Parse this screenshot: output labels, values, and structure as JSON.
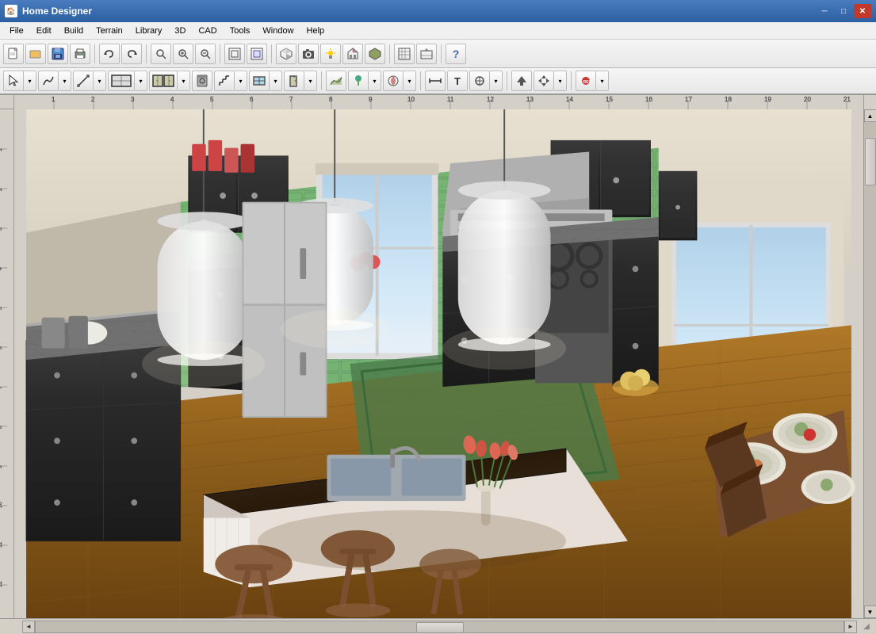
{
  "app": {
    "title": "Home Designer",
    "icon": "🏠"
  },
  "window_controls": {
    "minimize": "─",
    "maximize": "□",
    "close": "✕"
  },
  "menu": {
    "items": [
      "File",
      "Edit",
      "Build",
      "Terrain",
      "Library",
      "3D",
      "CAD",
      "Tools",
      "Window",
      "Help"
    ]
  },
  "toolbar1": {
    "buttons": [
      {
        "name": "new",
        "icon": "📄"
      },
      {
        "name": "open",
        "icon": "📂"
      },
      {
        "name": "save",
        "icon": "💾"
      },
      {
        "name": "print",
        "icon": "🖨"
      },
      {
        "name": "undo",
        "icon": "↩"
      },
      {
        "name": "redo",
        "icon": "↪"
      },
      {
        "name": "zoom-in-glass",
        "icon": "🔍"
      },
      {
        "name": "zoom-in-plus",
        "icon": "+"
      },
      {
        "name": "zoom-out",
        "icon": "-"
      },
      {
        "name": "zoom-fit",
        "icon": "⊞"
      },
      {
        "name": "zoom-window",
        "icon": "⊟"
      },
      {
        "name": "view-3d",
        "icon": "◈"
      },
      {
        "name": "pan",
        "icon": "✋"
      },
      {
        "name": "plan-view",
        "icon": "▦"
      },
      {
        "name": "elev-view",
        "icon": "⊡"
      },
      {
        "name": "cam",
        "icon": "📷"
      },
      {
        "name": "light",
        "icon": "💡"
      },
      {
        "name": "dollhouse",
        "icon": "🏠"
      },
      {
        "name": "overview",
        "icon": "⛰"
      },
      {
        "name": "help",
        "icon": "?"
      }
    ]
  },
  "toolbar2": {
    "buttons": [
      {
        "name": "select",
        "icon": "↖"
      },
      {
        "name": "polyline",
        "icon": "⌒"
      },
      {
        "name": "line-draw",
        "icon": "—"
      },
      {
        "name": "room",
        "icon": "⬜"
      },
      {
        "name": "cabinet",
        "icon": "🗄"
      },
      {
        "name": "appliance",
        "icon": "⊡"
      },
      {
        "name": "stairs",
        "icon": "≡"
      },
      {
        "name": "window-tool",
        "icon": "⊞"
      },
      {
        "name": "door-tool",
        "icon": "⊓"
      },
      {
        "name": "terrain",
        "icon": "∿"
      },
      {
        "name": "plant",
        "icon": "🌿"
      },
      {
        "name": "material",
        "icon": "◉"
      },
      {
        "name": "dimension",
        "icon": "↔"
      },
      {
        "name": "text-tool",
        "icon": "T"
      },
      {
        "name": "symbol",
        "icon": "⊕"
      },
      {
        "name": "arrow-up",
        "icon": "↑"
      },
      {
        "name": "move",
        "icon": "✛"
      },
      {
        "name": "record",
        "icon": "⏺"
      }
    ]
  },
  "status": {
    "left_text": ""
  },
  "kitchen_scene": {
    "description": "3D kitchen render with dark cabinets, granite countertops, hardwood floors, green tile backsplash, pendant lights, and kitchen island with sink"
  }
}
